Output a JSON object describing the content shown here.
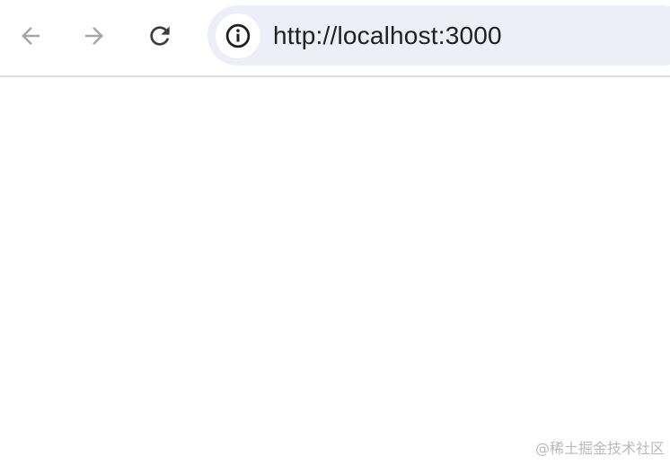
{
  "toolbar": {
    "back_icon": "arrow-left-icon",
    "forward_icon": "arrow-right-icon",
    "reload_icon": "reload-icon",
    "icon_color_disabled": "#a6a6a6",
    "icon_color_active": "#3c3c3c"
  },
  "omnibox": {
    "site_info_icon": "info-icon",
    "url": "http://localhost:3000",
    "background": "#edeef7"
  },
  "watermark": {
    "text": "@稀土掘金技术社区"
  }
}
